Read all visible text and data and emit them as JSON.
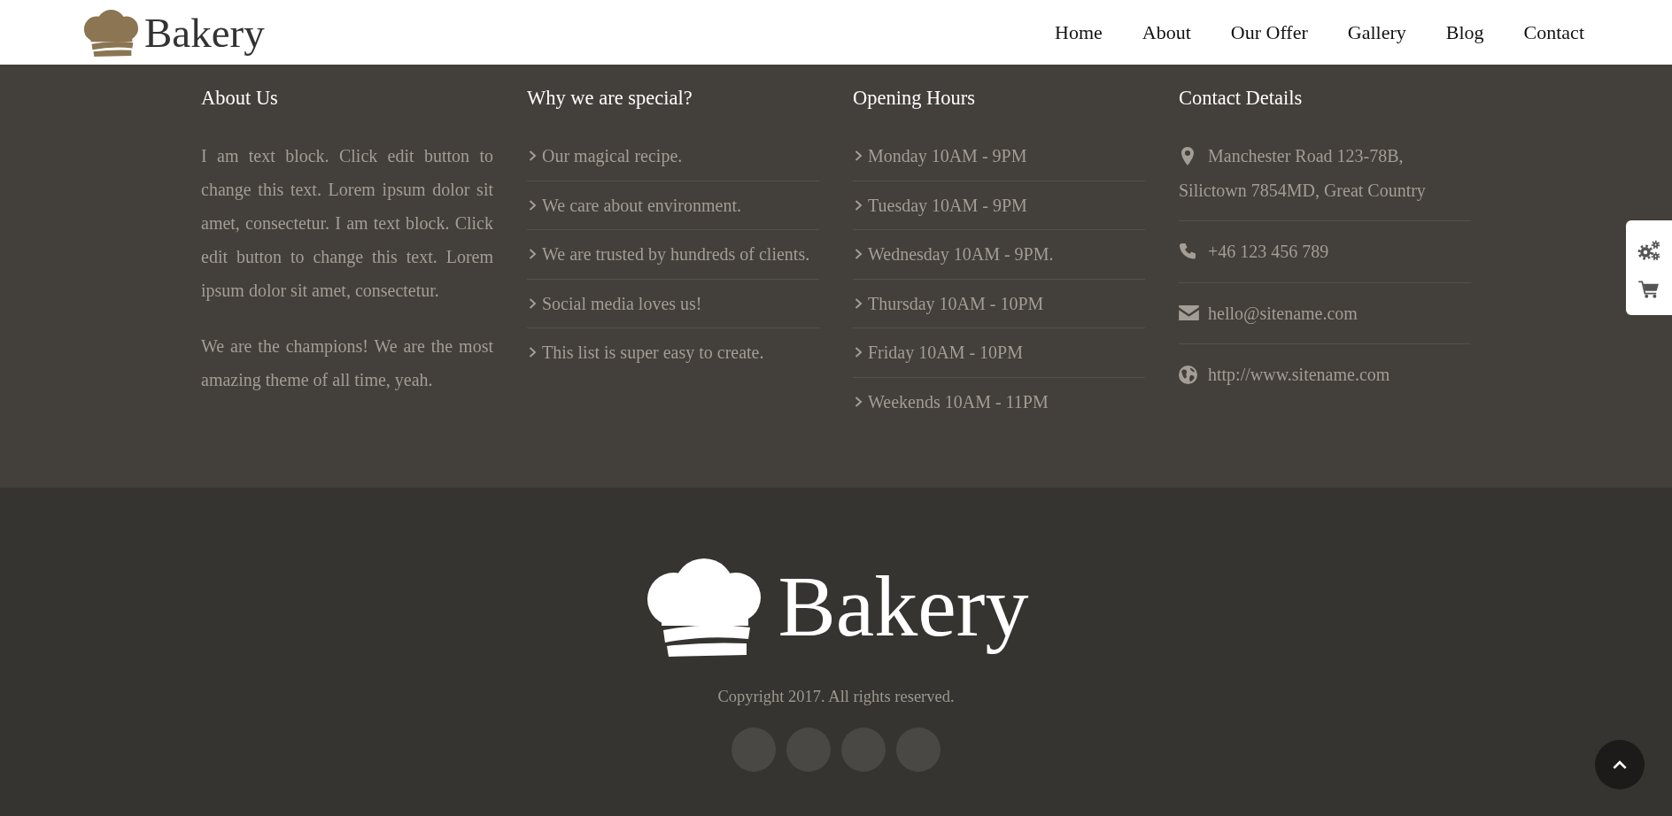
{
  "header": {
    "logo": {
      "text": "Bakery"
    },
    "nav": [
      {
        "label": "Home"
      },
      {
        "label": "About"
      },
      {
        "label": "Our Offer"
      },
      {
        "label": "Gallery"
      },
      {
        "label": "Blog"
      },
      {
        "label": "Contact"
      }
    ]
  },
  "footer_columns": [
    {
      "kind": "text",
      "title": "About Us",
      "paragraphs": [
        "I am text block. Click edit button to change this text. Lorem ipsum dolor sit amet, consectetur. I am text block. Click edit button to change this text. Lorem ipsum dolor sit amet, consectetur.",
        "We are the champions! We are the most amazing theme of all time, yeah."
      ]
    },
    {
      "kind": "list",
      "title": "Why we are special?",
      "items": [
        "Our magical recipe.",
        "We care about environment.",
        "We are trusted by hundreds of clients.",
        "Social media loves us!",
        "This list is super easy to create."
      ]
    },
    {
      "kind": "list",
      "title": "Opening Hours",
      "items": [
        "Monday 10AM - 9PM",
        "Tuesday 10AM - 9PM",
        "Wednesday 10AM - 9PM.",
        "Thursday 10AM - 10PM",
        "Friday 10AM - 10PM",
        "Weekends 10AM - 11PM"
      ]
    },
    {
      "kind": "contact",
      "title": "Contact Details",
      "items": [
        {
          "kind": "address",
          "lines": [
            "Manchester Road 123-78B,",
            "Silictown 7854MD, Great Country"
          ]
        },
        {
          "kind": "phone",
          "lines": [
            "+46 123 456 789"
          ]
        },
        {
          "kind": "email",
          "lines": [
            "hello@sitename.com"
          ]
        },
        {
          "kind": "website",
          "lines": [
            "http://www.sitename.com"
          ]
        }
      ]
    }
  ],
  "footer_bottom": {
    "logo": {
      "text": "Bakery"
    },
    "copyright": "Copyright 2017. All rights reserved."
  }
}
